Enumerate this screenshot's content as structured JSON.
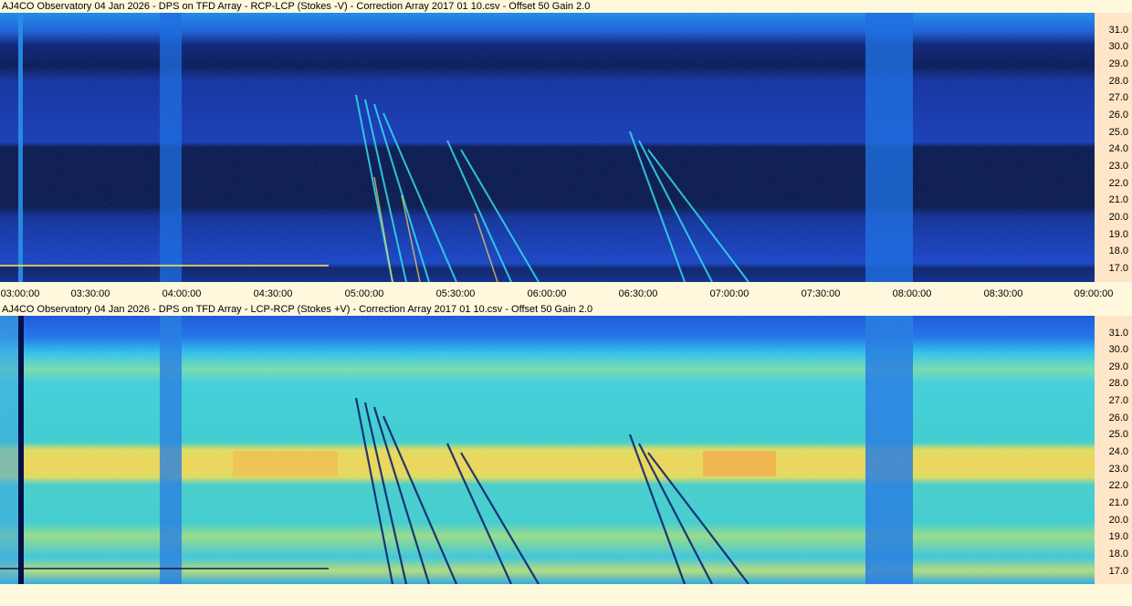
{
  "panels": [
    {
      "title": "AJ4CO Observatory 04 Jan 2026  -  DPS on TFD Array  -  RCP-LCP (Stokes -V)  -  Correction Array 2017 01 10.csv  -  Offset 50  Gain 2.0",
      "mode": "negative"
    },
    {
      "title": "AJ4CO Observatory 04 Jan 2026  -  DPS on TFD Array  -  LCP-RCP (Stokes +V)  -  Correction Array 2017 01 10.csv  -  Offset 50  Gain 2.0",
      "mode": "positive"
    }
  ],
  "y_ticks": [
    "31.0",
    "30.0",
    "29.0",
    "28.0",
    "27.0",
    "26.0",
    "25.0",
    "24.0",
    "23.0",
    "22.0",
    "21.0",
    "20.0",
    "19.0",
    "18.0",
    "17.0"
  ],
  "x_ticks": [
    "03:00:00",
    "03:30:00",
    "04:00:00",
    "04:30:00",
    "05:00:00",
    "05:30:00",
    "06:00:00",
    "06:30:00",
    "07:00:00",
    "07:30:00",
    "08:00:00",
    "08:30:00",
    "09:00:00"
  ],
  "colors": {
    "background": "#fff8dc",
    "axis_strip": "#ffe6c8",
    "spectrogram_dark": "#05104a",
    "spectrogram_blue": "#1a4fd8",
    "spectrogram_cyan": "#33ccee",
    "spectrogram_yellow": "#ffe14a",
    "spectrogram_orange": "#f4a04a"
  }
}
